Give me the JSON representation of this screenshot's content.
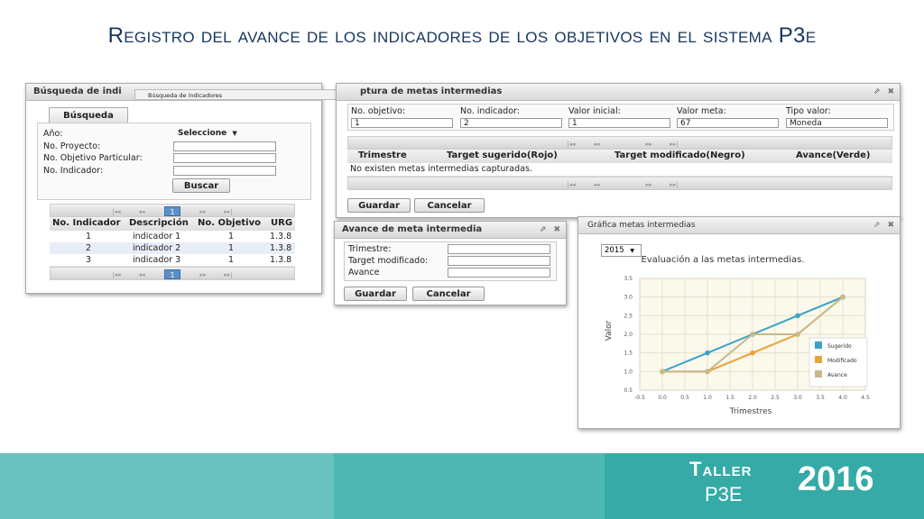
{
  "slide": {
    "title": "Registro del avance de los indicadores de los objetivos en el sistema P3e"
  },
  "search_window": {
    "title": "Búsqueda de indi",
    "tooltip": "Búsqueda de indicadores",
    "tab": "Búsqueda",
    "fields": [
      {
        "label": "Año:",
        "value": "Seleccione"
      },
      {
        "label": "No. Proyecto:",
        "value": ""
      },
      {
        "label": "No. Objetivo Particular:",
        "value": ""
      },
      {
        "label": "No. Indicador:",
        "value": ""
      }
    ],
    "search_button": "Buscar",
    "pager_page": "1",
    "table": {
      "headers": [
        "No. Indicador",
        "Descripción",
        "No. Objetivo",
        "URG"
      ],
      "rows": [
        [
          "1",
          "indicador 1",
          "1",
          "1.3.8"
        ],
        [
          "2",
          "indicador 2",
          "1",
          "1.3.8"
        ],
        [
          "3",
          "indicador 3",
          "1",
          "1.3.8"
        ]
      ]
    }
  },
  "capture_window": {
    "title": "ptura de metas intermedias",
    "fields": [
      {
        "label": "No. objetivo:",
        "value": "1"
      },
      {
        "label": "No. indicador:",
        "value": "2"
      },
      {
        "label": "Valor inicial:",
        "value": "1"
      },
      {
        "label": "Valor meta:",
        "value": "67"
      },
      {
        "label": "Tipo valor:",
        "value": "Moneda"
      }
    ],
    "table_headers": [
      "Trimestre",
      "Target sugerido(Rojo)",
      "Target modificado(Negro)",
      "Avance(Verde)"
    ],
    "empty_message": "No existen metas intermedias capturadas.",
    "save_button": "Guardar",
    "cancel_button": "Cancelar"
  },
  "progress_window": {
    "title": "Avance de meta intermedia",
    "fields": [
      {
        "label": "Trimestre:",
        "value": ""
      },
      {
        "label": "Target modificado:",
        "value": ""
      },
      {
        "label": "Avance",
        "value": ""
      }
    ],
    "save_button": "Guardar",
    "cancel_button": "Cancelar"
  },
  "chart_window": {
    "title": "Gráfica metas intermedias",
    "year_select": "2015"
  },
  "chart_data": {
    "type": "line",
    "title": "Evaluación a las metas intermedias.",
    "xlabel": "Trimestres",
    "ylabel": "Valor",
    "xlim": [
      -0.5,
      4.5
    ],
    "ylim": [
      0.5,
      3.5
    ],
    "xticks": [
      "-0.5",
      "0.0",
      "0.5",
      "1.0",
      "1.5",
      "2.0",
      "2.5",
      "3.0",
      "3.5",
      "4.0",
      "4.5"
    ],
    "yticks": [
      "0.5",
      "1.0",
      "1.5",
      "2.0",
      "2.5",
      "3.0",
      "3.5"
    ],
    "grid": true,
    "legend_position": "right",
    "series": [
      {
        "name": "Sugerido",
        "color": "#3aa3c8",
        "x": [
          0,
          1,
          2,
          3,
          4
        ],
        "values": [
          1.0,
          1.5,
          2.0,
          2.5,
          3.0
        ]
      },
      {
        "name": "Modificado",
        "color": "#e8a33a",
        "x": [
          0,
          1,
          2,
          3,
          4
        ],
        "values": [
          1.0,
          1.0,
          1.5,
          2.0,
          3.0
        ]
      },
      {
        "name": "Avance",
        "color": "#c8b98a",
        "x": [
          0,
          1,
          2,
          3,
          4
        ],
        "values": [
          1.0,
          1.0,
          2.0,
          2.0,
          3.0
        ]
      }
    ]
  },
  "footer": {
    "taller": "Taller",
    "p3e": "P3E",
    "year": "2016"
  },
  "colors": {
    "title": "#17365d",
    "footer": "#35aaa6",
    "selected_page": "#5b8fc7"
  }
}
